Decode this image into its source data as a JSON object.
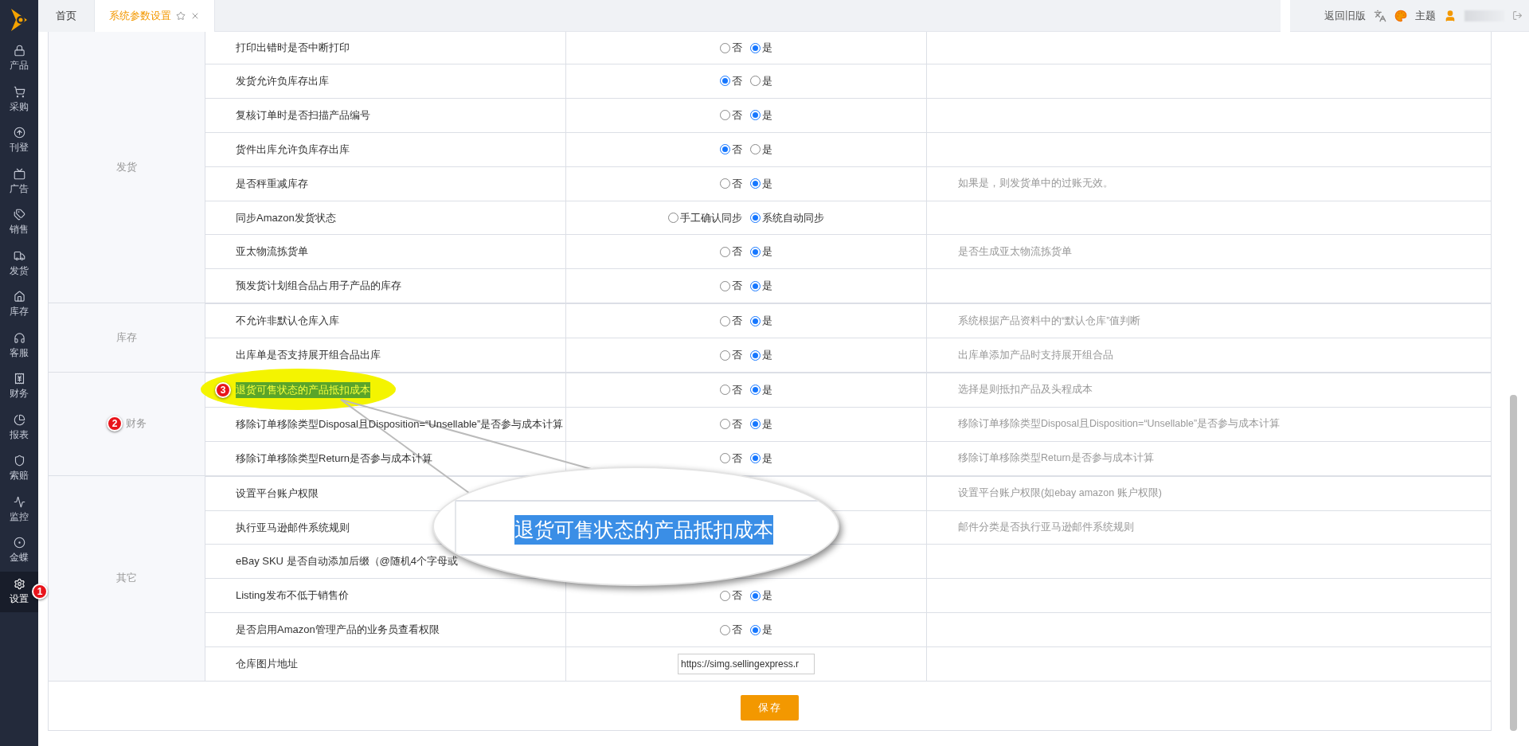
{
  "tabs": [
    {
      "label": "首页",
      "selected": false
    },
    {
      "label": "系统参数设置",
      "selected": true
    }
  ],
  "header": {
    "old_version_link": "返回旧版",
    "theme": "主题"
  },
  "sidebar": {
    "items": [
      {
        "label": "产品",
        "selected": false
      },
      {
        "label": "采购",
        "selected": false
      },
      {
        "label": "刊登",
        "selected": false
      },
      {
        "label": "广告",
        "selected": false
      },
      {
        "label": "销售",
        "selected": false
      },
      {
        "label": "发货",
        "selected": false
      },
      {
        "label": "库存",
        "selected": false
      },
      {
        "label": "客服",
        "selected": false
      },
      {
        "label": "财务",
        "selected": false
      },
      {
        "label": "报表",
        "selected": false
      },
      {
        "label": "索赔",
        "selected": false
      },
      {
        "label": "监控",
        "selected": false
      },
      {
        "label": "金蝶",
        "selected": false
      },
      {
        "label": "设置",
        "selected": true,
        "badge": "1"
      }
    ]
  },
  "groups": [
    {
      "name": "发货",
      "rows": [
        {
          "label": "打印出错时是否中断打印",
          "kind": "radio",
          "options": [
            {
              "label": "否",
              "selected": false
            },
            {
              "label": "是",
              "selected": true
            }
          ]
        },
        {
          "label": "发货允许负库存出库",
          "kind": "radio",
          "options": [
            {
              "label": "否",
              "selected": true
            },
            {
              "label": "是",
              "selected": false
            }
          ]
        },
        {
          "label": "复核订单时是否扫描产品编号",
          "kind": "radio",
          "options": [
            {
              "label": "否",
              "selected": false
            },
            {
              "label": "是",
              "selected": true
            }
          ]
        },
        {
          "label": "货件出库允许负库存出库",
          "kind": "radio",
          "options": [
            {
              "label": "否",
              "selected": true
            },
            {
              "label": "是",
              "selected": false
            }
          ]
        },
        {
          "label": "是否秤重减库存",
          "kind": "radio",
          "options": [
            {
              "label": "否",
              "selected": false
            },
            {
              "label": "是",
              "selected": true
            }
          ],
          "note": "如果是，则发货单中的过账无效。"
        },
        {
          "label": "同步Amazon发货状态",
          "kind": "radio",
          "options": [
            {
              "label": "手工确认同步",
              "selected": false
            },
            {
              "label": "系统自动同步",
              "selected": true
            }
          ]
        },
        {
          "label": "亚太物流拣货单",
          "kind": "radio",
          "options": [
            {
              "label": "否",
              "selected": false
            },
            {
              "label": "是",
              "selected": true
            }
          ],
          "note": "是否生成亚太物流拣货单"
        },
        {
          "label": "预发货计划组合品占用子产品的库存",
          "kind": "radio",
          "options": [
            {
              "label": "否",
              "selected": false
            },
            {
              "label": "是",
              "selected": true
            }
          ]
        }
      ]
    },
    {
      "name": "库存",
      "rows": [
        {
          "label": "不允许非默认仓库入库",
          "kind": "radio",
          "options": [
            {
              "label": "否",
              "selected": false
            },
            {
              "label": "是",
              "selected": true
            }
          ],
          "note": "系统根据产品资料中的“默认仓库”值判断"
        },
        {
          "label": "出库单是否支持展开组合品出库",
          "kind": "radio",
          "options": [
            {
              "label": "否",
              "selected": false
            },
            {
              "label": "是",
              "selected": true
            }
          ],
          "note": "出库单添加产品时支持展开组合品"
        }
      ]
    },
    {
      "name": "财务",
      "badge": "2",
      "rows": [
        {
          "label": "退货可售状态的产品抵扣成本",
          "highlighted": true,
          "badge": "3",
          "kind": "radio",
          "options": [
            {
              "label": "否",
              "selected": false
            },
            {
              "label": "是",
              "selected": true
            }
          ],
          "note": "选择是则抵扣产品及头程成本"
        },
        {
          "label": "移除订单移除类型Disposal且Disposition=“Unsellable”是否参与成本计算",
          "kind": "radio",
          "options": [
            {
              "label": "否",
              "selected": false
            },
            {
              "label": "是",
              "selected": true
            }
          ],
          "note": "移除订单移除类型Disposal且Disposition=“Unsellable”是否参与成本计算"
        },
        {
          "label": "移除订单移除类型Return是否参与成本计算",
          "kind": "radio",
          "options": [
            {
              "label": "否",
              "selected": false
            },
            {
              "label": "是",
              "selected": true
            }
          ],
          "note": "移除订单移除类型Return是否参与成本计算"
        }
      ]
    },
    {
      "name": "其它",
      "rows": [
        {
          "label": "设置平台账户权限",
          "kind": "covered",
          "note": "设置平台账户权限(如ebay amazon 账户权限)"
        },
        {
          "label": "执行亚马逊邮件系统规则",
          "kind": "covered",
          "note": "邮件分类是否执行亚马逊邮件系统规则"
        },
        {
          "label": "eBay SKU 是否自动添加后缀（@随机4个字母或",
          "kind": "covered"
        },
        {
          "label": "Listing发布不低于销售价",
          "kind": "radio",
          "options": [
            {
              "label": "否",
              "selected": false
            },
            {
              "label": "是",
              "selected": true
            }
          ]
        },
        {
          "label": "是否启用Amazon管理产品的业务员查看权限",
          "kind": "radio",
          "options": [
            {
              "label": "否",
              "selected": false
            },
            {
              "label": "是",
              "selected": true
            }
          ]
        },
        {
          "label": "仓库图片地址",
          "kind": "input",
          "value": "https://simg.sellingexpress.r"
        }
      ]
    }
  ],
  "magnifier": {
    "text": "退货可售状态的产品抵扣成本"
  },
  "save_button": "保存"
}
